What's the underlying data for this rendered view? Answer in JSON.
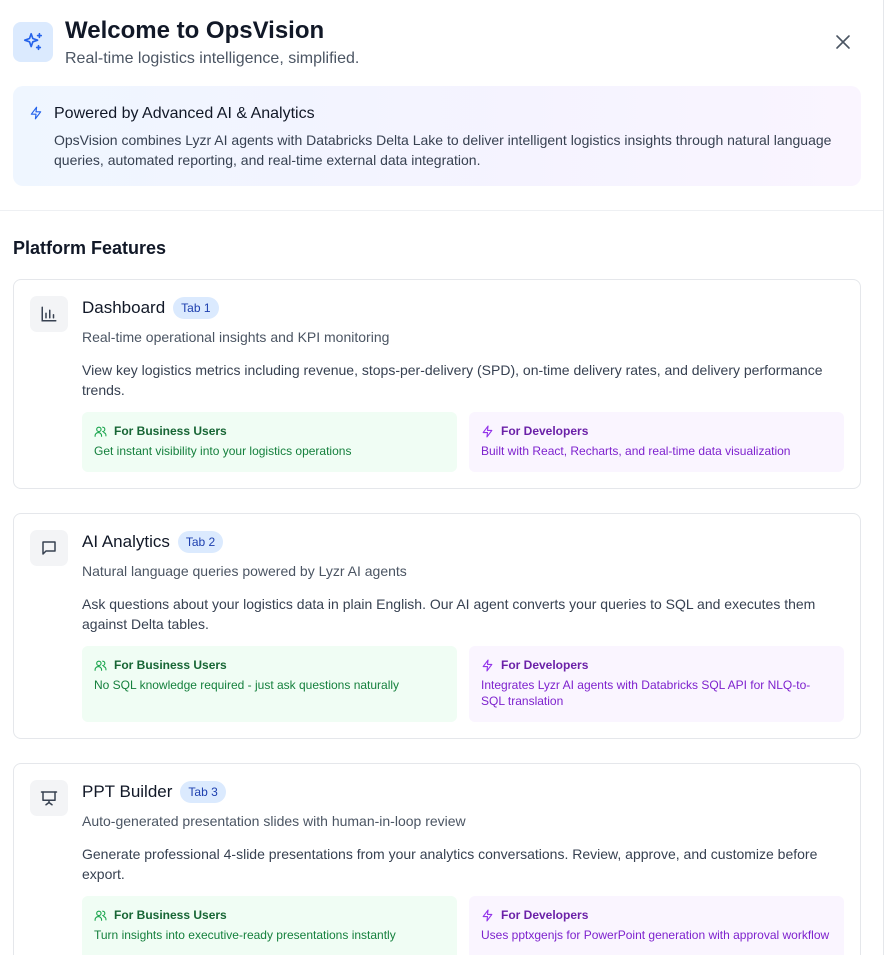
{
  "header": {
    "title": "Welcome to OpsVision",
    "subtitle": "Real-time logistics intelligence, simplified."
  },
  "powered": {
    "title": "Powered by Advanced AI & Analytics",
    "text": "OpsVision combines Lyzr AI agents with Databricks Delta Lake to deliver intelligent logistics insights through natural language queries, automated reporting, and real-time external data integration."
  },
  "features": {
    "section_title": "Platform Features",
    "items": [
      {
        "name": "Dashboard",
        "badge": "Tab 1",
        "icon": "bar-chart-icon",
        "tagline": "Real-time operational insights and KPI monitoring",
        "description": "View key logistics metrics including revenue, stops-per-delivery (SPD), on-time delivery rates, and delivery performance trends.",
        "business_label": "For Business Users",
        "business_text": "Get instant visibility into your logistics operations",
        "developer_label": "For Developers",
        "developer_text": "Built with React, Recharts, and real-time data visualization"
      },
      {
        "name": "AI Analytics",
        "badge": "Tab 2",
        "icon": "message-square-icon",
        "tagline": "Natural language queries powered by Lyzr AI agents",
        "description": "Ask questions about your logistics data in plain English. Our AI agent converts your queries to SQL and executes them against Delta tables.",
        "business_label": "For Business Users",
        "business_text": "No SQL knowledge required - just ask questions naturally",
        "developer_label": "For Developers",
        "developer_text": "Integrates Lyzr AI agents with Databricks SQL API for NLQ-to-SQL translation"
      },
      {
        "name": "PPT Builder",
        "badge": "Tab 3",
        "icon": "presentation-icon",
        "tagline": "Auto-generated presentation slides with human-in-loop review",
        "description": "Generate professional 4-slide presentations from your analytics conversations. Review, approve, and customize before export.",
        "business_label": "For Business Users",
        "business_text": "Turn insights into executive-ready presentations instantly",
        "developer_label": "For Developers",
        "developer_text": "Uses pptxgenjs for PowerPoint generation with approval workflow"
      }
    ]
  },
  "colors": {
    "accent_blue": "#2563eb",
    "business_green": "#15803d",
    "developer_purple": "#7e22ce"
  }
}
